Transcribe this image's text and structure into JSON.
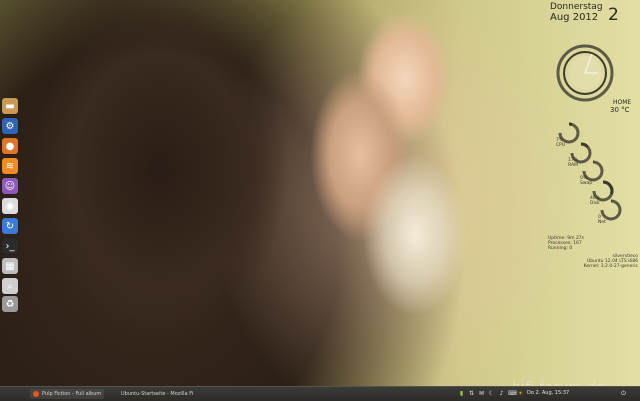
{
  "launcher": {
    "items": [
      {
        "icon": "home-folder-icon",
        "glyph": "",
        "color": "#c89a55"
      },
      {
        "icon": "system-settings-icon",
        "glyph": "",
        "color": "#2f63b6"
      },
      {
        "icon": "firefox-icon",
        "glyph": "",
        "color": "#e0752a"
      },
      {
        "icon": "rss-feed-icon",
        "glyph": "",
        "color": "#f08a24"
      },
      {
        "icon": "empathy-chat-icon",
        "glyph": "",
        "color": "#8e5bbd"
      },
      {
        "icon": "screenshot-icon",
        "glyph": "",
        "color": "#dcdcdc"
      },
      {
        "icon": "update-manager-icon",
        "glyph": "",
        "color": "#3a7bd5"
      },
      {
        "icon": "terminal-icon",
        "glyph": "",
        "color": "#2b2b2b"
      },
      {
        "icon": "workspace-switcher-icon",
        "glyph": "",
        "color": "#bdbdbd"
      },
      {
        "icon": "magnifier-icon",
        "glyph": "",
        "color": "#cfcfcf"
      },
      {
        "icon": "trash-icon",
        "glyph": "",
        "color": "#9a9a9a"
      }
    ]
  },
  "conky": {
    "day": "Donnerstag",
    "date_num": "2",
    "month_year": "Aug 2012",
    "home_label": "HOME",
    "temperature": "30 °C",
    "gauges": [
      {
        "label": "7%",
        "sub": "CPU",
        "value": 7
      },
      {
        "label": "17%",
        "sub": "RAM",
        "value": 17
      },
      {
        "label": "0%",
        "sub": "Swap",
        "value": 0
      },
      {
        "label": "40%",
        "sub": "Disk",
        "value": 40
      },
      {
        "label": "0",
        "sub": "Net",
        "value": 0
      }
    ],
    "sysinfo": [
      "Uptime: 9m 27s",
      "Processes: 167",
      "Running: 0"
    ],
    "osinfo": [
      "silverstieco",
      "Ubuntu 12.04 LTS i686",
      "Kernel: 3.2.0-27-generic"
    ]
  },
  "panel": {
    "tasks": [
      {
        "label": "Pulp Fiction - Full album",
        "icon": "ubuntu-logo-icon"
      },
      {
        "label": "Ubuntu-Startseite - Mozilla Fi",
        "icon": "firefox-icon"
      }
    ],
    "clock": "Do 2. Aug, 15:37"
  },
  "watermark": "hifi-forum.de",
  "colors": {
    "panel_bg": "#3c3b37",
    "gauge_dark": "#3a3a2e",
    "gauge_ring": "#5d5b45"
  }
}
